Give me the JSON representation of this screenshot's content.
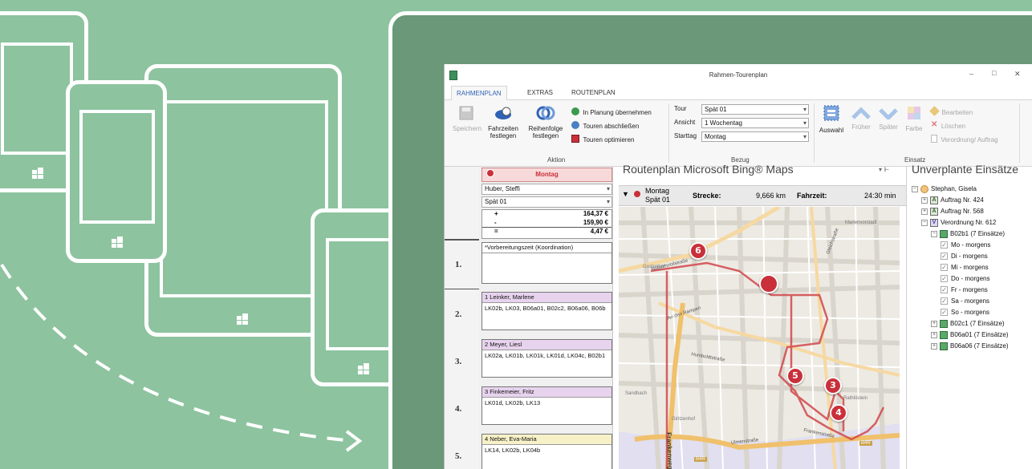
{
  "window": {
    "title": "Rahmen-Tourenplan",
    "minimize": "–",
    "maximize": "□",
    "close": "✕"
  },
  "tabs": [
    "RAHMENPLAN",
    "EXTRAS",
    "ROUTENPLAN"
  ],
  "ribbon": {
    "aktion": {
      "speichern": "Speichern",
      "fahrzeiten": [
        "Fahrzeiten",
        "festlegen"
      ],
      "reihenfolge": [
        "Reihenfolge",
        "festlegen"
      ],
      "in_planung": "In Planung übernehmen",
      "abschliessen": "Touren abschließen",
      "optimieren": "Touren optimieren",
      "label": "Aktion"
    },
    "bezug": {
      "tour_label": "Tour",
      "tour_value": "Spät 01",
      "ansicht_label": "Ansicht",
      "ansicht_value": "1 Wochentag",
      "starttag_label": "Starttag",
      "starttag_value": "Montag",
      "label": "Bezug"
    },
    "einsatz": {
      "auswahl": "Auswahl",
      "frueher": "Früher",
      "spaeter": "Später",
      "farbe": "Farbe",
      "bearbeiten": "Bearbeiten",
      "loeschen": "Löschen",
      "verordnung": "Verordnung/ Auftrag",
      "label": "Einsatz"
    }
  },
  "planner": {
    "day": "Montag",
    "person": "Huber, Steffi",
    "tour": "Spät 01",
    "sums": [
      {
        "sign": "+",
        "value": "164,37 €"
      },
      {
        "sign": "-",
        "value": "159,90 €"
      },
      {
        "sign": "=",
        "value": "4,47 €"
      }
    ],
    "rows": [
      {
        "num": "1.",
        "head": "*Vorbereitungszeit (Koordination)",
        "body": ""
      },
      {
        "num": "2.",
        "head": "1  Leinker, Marlene",
        "body": "LK02b, LK03, B06a01, B02c2, B06a06, B06b"
      },
      {
        "num": "3.",
        "head": "2  Meyer, Liesl",
        "body": "LK02a, LK01b, LK01k, LK01d, LK04c, B02b1"
      },
      {
        "num": "4.",
        "head": "3  Finkemeier, Fritz",
        "body": "LK01d, LK02b, LK13"
      },
      {
        "num": "5.",
        "head": "4  Neber, Eva-Maria",
        "body": "LK14, LK02b, LK04b"
      }
    ]
  },
  "map": {
    "title": "Routenplan Microsoft Bing® Maps",
    "day": "Montag",
    "tour": "Spät 01",
    "strecke_label": "Strecke:",
    "strecke_value": "9,666 km",
    "fahrzeit_label": "Fahrzeit:",
    "fahrzeit_value": "24:30 min",
    "pins": [
      "6",
      "5",
      "3",
      "4"
    ],
    "streets": [
      "Nobelmobilstraße",
      "Gleichstraße",
      "An den Rampen",
      "Humboldtstraße",
      "Frankenstraße",
      "Ulmenstraße",
      "Frankenweg",
      "Sandbach",
      "Giritzenhof",
      "Gostenhof",
      "Marienvorstadt",
      "Rathlöstein",
      "B4R",
      "B4R"
    ]
  },
  "unplanned": {
    "title": "Unverplante Einsätze",
    "items": [
      {
        "level": 0,
        "box": "⊟",
        "icon": "person",
        "text": "Stephan, Gisela"
      },
      {
        "level": 1,
        "box": "⊞",
        "icon": "A",
        "text": "Auftrag Nr. 424"
      },
      {
        "level": 1,
        "box": "⊞",
        "icon": "A",
        "text": "Auftrag Nr. 568"
      },
      {
        "level": 1,
        "box": "⊟",
        "icon": "V",
        "text": "Verordnung Nr. 612"
      },
      {
        "level": 2,
        "box": "⊟",
        "icon": "doc",
        "text": "B02b1 (7 Einsätze)"
      },
      {
        "level": 3,
        "box": "",
        "icon": "chk",
        "text": "Mo - morgens"
      },
      {
        "level": 3,
        "box": "",
        "icon": "chk",
        "text": "Di - morgens"
      },
      {
        "level": 3,
        "box": "",
        "icon": "chk",
        "text": "Mi - morgens"
      },
      {
        "level": 3,
        "box": "",
        "icon": "chk",
        "text": "Do - morgens"
      },
      {
        "level": 3,
        "box": "",
        "icon": "chk",
        "text": "Fr - morgens"
      },
      {
        "level": 3,
        "box": "",
        "icon": "chk",
        "text": "Sa - morgens"
      },
      {
        "level": 3,
        "box": "",
        "icon": "chk",
        "text": "So - morgens"
      },
      {
        "level": 2,
        "box": "⊞",
        "icon": "doc",
        "text": "B02c1 (7 Einsätze)"
      },
      {
        "level": 2,
        "box": "⊞",
        "icon": "doc",
        "text": "B06a01 (7 Einsätze)"
      },
      {
        "level": 2,
        "box": "⊞",
        "icon": "doc",
        "text": "B06a06 (7 Einsätze)"
      }
    ]
  },
  "colors": {
    "background": "#8dc39f",
    "panel": "#6a9878",
    "route": "#d0464b",
    "pin": "#c9303a"
  }
}
